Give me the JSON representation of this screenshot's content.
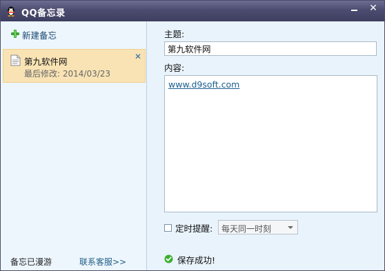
{
  "window": {
    "title": "QQ备忘录",
    "icons": {
      "app": "qq-penguin-icon",
      "minimize": "minimize-icon",
      "close": "close-icon"
    }
  },
  "sidebar": {
    "new_note_label": "新建备忘",
    "new_note_icon": "green-plus-icon",
    "notes": [
      {
        "title": "第九软件网",
        "meta": "最后修改: 2014/03/23",
        "icon": "note-document-icon",
        "delete_icon": "delete-x-icon"
      }
    ],
    "footer": {
      "roam_status": "备忘已漫游",
      "support_link": "联系客服>>"
    }
  },
  "editor": {
    "subject_label": "主题:",
    "subject_value": "第九软件网",
    "content_label": "内容:",
    "content_link": "www.d9soft.com",
    "reminder_label": "定时提醒:",
    "reminder_checked": false,
    "reminder_select_value": "每天同一时刻",
    "status_text": "保存成功!",
    "status_icon": "success-check-icon"
  },
  "colors": {
    "titlebar": "#4c4c70",
    "selected_item": "#f9e3b4",
    "panel_bg": "#e9f3fb",
    "link": "#1a5e8f",
    "success": "#3cae2e"
  }
}
